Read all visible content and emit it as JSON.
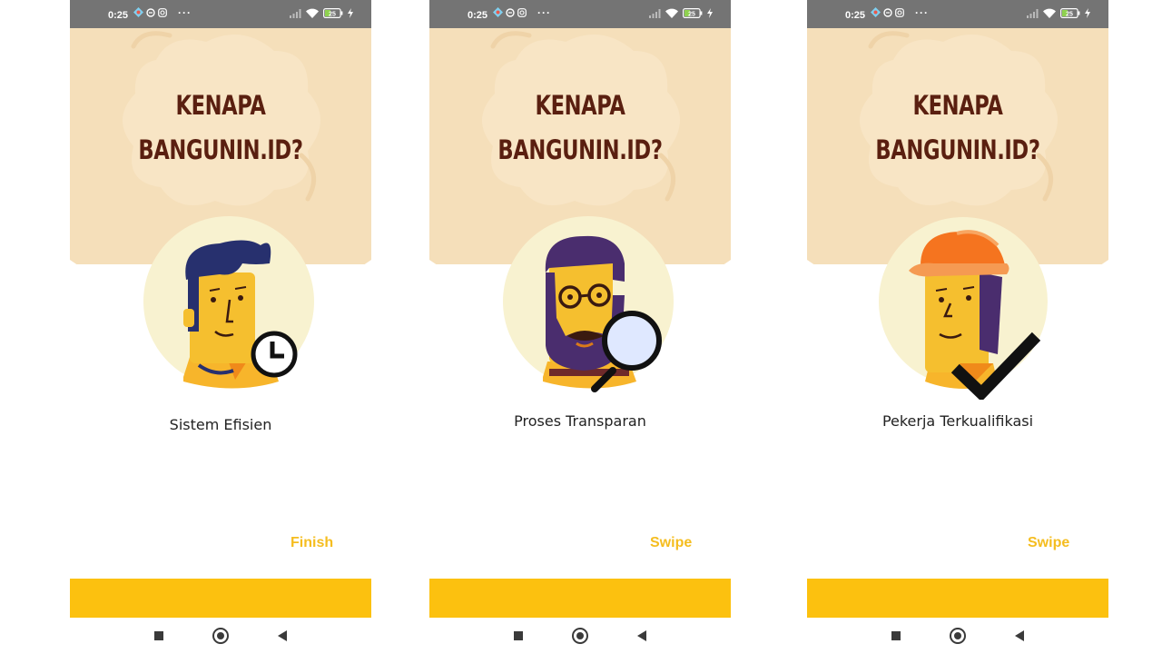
{
  "status_bar": {
    "time": "0:25",
    "more": "···",
    "battery": "25"
  },
  "colors": {
    "hero_bg": "#f5dfba",
    "headline": "#5a1f10",
    "action": "#f5bd1f",
    "bottom_bar": "#fcc10f",
    "status_bar": "#747474"
  },
  "screens": [
    {
      "headline_line1": "KENAPA",
      "headline_line2": "BANGUNIN.ID?",
      "illustration": "man-with-clock",
      "feature": "Sistem Efisien",
      "action": "Finish"
    },
    {
      "headline_line1": "KENAPA",
      "headline_line2": "BANGUNIN.ID?",
      "illustration": "bearded-man-with-magnifier",
      "feature": "Proses Transparan",
      "action": "Swipe"
    },
    {
      "headline_line1": "KENAPA",
      "headline_line2": "BANGUNIN.ID?",
      "illustration": "worker-with-helmet-and-checkmark",
      "feature": "Pekerja Terkualifikasi",
      "action": "Swipe"
    }
  ]
}
